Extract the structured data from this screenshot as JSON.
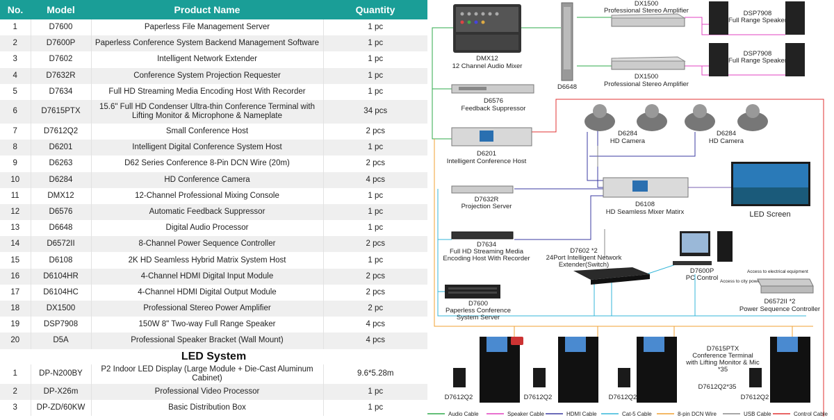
{
  "table": {
    "headers": [
      "No.",
      "Model",
      "Product Name",
      "Quantity"
    ],
    "rows": [
      {
        "no": "1",
        "model": "D7600",
        "name": "Paperless File Management Server",
        "qty": "1 pc"
      },
      {
        "no": "2",
        "model": "D7600P",
        "name": "Paperless Conference System Backend Management Software",
        "qty": "1 pc"
      },
      {
        "no": "3",
        "model": "D7602",
        "name": "Intelligent Network Extender",
        "qty": "1 pc"
      },
      {
        "no": "4",
        "model": "D7632R",
        "name": "Conference System Projection Requester",
        "qty": "1 pc"
      },
      {
        "no": "5",
        "model": "D7634",
        "name": "Full HD Streaming Media Encoding Host With Recorder",
        "qty": "1 pc"
      },
      {
        "no": "6",
        "model": "D7615PTX",
        "name": "15.6\" Full HD Condenser Ultra-thin Conference Terminal with Lifting Monitor & Microphone & Nameplate",
        "qty": "34 pcs"
      },
      {
        "no": "7",
        "model": "D7612Q2",
        "name": "Small Conference Host",
        "qty": "2 pcs"
      },
      {
        "no": "8",
        "model": "D6201",
        "name": "Intelligent Digital Conference System Host",
        "qty": "1 pc"
      },
      {
        "no": "9",
        "model": "D6263",
        "name": "D62 Series Conference 8-Pin DCN Wire (20m)",
        "qty": "2 pcs"
      },
      {
        "no": "10",
        "model": "D6284",
        "name": "HD Conference Camera",
        "qty": "4 pcs"
      },
      {
        "no": "11",
        "model": "DMX12",
        "name": "12-Channel Professional Mixing Console",
        "qty": "1 pc"
      },
      {
        "no": "12",
        "model": "D6576",
        "name": "Automatic Feedback Suppressor",
        "qty": "1 pc"
      },
      {
        "no": "13",
        "model": "D6648",
        "name": "Digital Audio Processor",
        "qty": "1 pc"
      },
      {
        "no": "14",
        "model": "D6572II",
        "name": "8-Channel Power Sequence Controller",
        "qty": "2 pcs"
      },
      {
        "no": "15",
        "model": "D6108",
        "name": "2K HD Seamless Hybrid Matrix System Host",
        "qty": "1 pc"
      },
      {
        "no": "16",
        "model": "D6104HR",
        "name": "4-Channel HDMI Digital Input Module",
        "qty": "2 pcs"
      },
      {
        "no": "17",
        "model": "D6104HC",
        "name": "4-Channel HDMI Digital Output Module",
        "qty": "2 pcs"
      },
      {
        "no": "18",
        "model": "DX1500",
        "name": "Professional Stereo Power Amplifier",
        "qty": "2 pc"
      },
      {
        "no": "19",
        "model": "DSP7908",
        "name": "150W 8\" Two-way Full Range Speaker",
        "qty": "4 pcs"
      },
      {
        "no": "20",
        "model": "D5A",
        "name": "Professional Speaker Bracket (Wall Mount)",
        "qty": "4 pcs"
      }
    ],
    "led_title": "LED System",
    "led_rows": [
      {
        "no": "1",
        "model": "DP-N200BY",
        "name": "P2 Indoor LED Display  (Large Module + Die-Cast Aluminum Cabinet)",
        "qty": "9.6*5.28m"
      },
      {
        "no": "2",
        "model": "DP-X26m",
        "name": "Professional Video Processor",
        "qty": "1 pc"
      },
      {
        "no": "3",
        "model": "DP-ZD/60KW",
        "name": "Basic Distribution Box",
        "qty": "1 pc"
      }
    ]
  },
  "diagram": {
    "dx1500_top": {
      "model": "DX1500",
      "name": "Professional Stereo Amplifier"
    },
    "dx1500_bottom": {
      "model": "DX1500",
      "name": "Professional Stereo Amplifier"
    },
    "dsp_top": {
      "model": "DSP7908",
      "name": "Full Range Speaker"
    },
    "dsp_bottom": {
      "model": "DSP7908",
      "name": "Full Range Speaker"
    },
    "dmx12": {
      "model": "DMX12",
      "name": "12 Channel Audio Mixer"
    },
    "d6648": "D6648",
    "d6576": {
      "model": "D6576",
      "name": "Feedback Suppressor"
    },
    "d6201": {
      "model": "D6201",
      "name": "Intelligent Conference Host"
    },
    "d6284_left": {
      "model": "D6284",
      "name": "HD Camera"
    },
    "d6284_right": {
      "model": "D6284",
      "name": "HD Camera"
    },
    "d7632r": {
      "model": "D7632R",
      "name": "Projection Server"
    },
    "d6108": {
      "model": "D6108",
      "name": "HD Seamless Mixer Matirx"
    },
    "led_screen": "LED Screen",
    "d7634": {
      "model": "D7634",
      "line1": "Full HD Streaming Media",
      "line2": "Encoding Host With Recorder"
    },
    "d7602": {
      "line1": "D7602 *2",
      "line2": "24Port Intelligent Network",
      "line3": "Extender(Switch)"
    },
    "d7600p": {
      "model": "D7600P",
      "name": "PC Control"
    },
    "d7600": {
      "model": "D7600",
      "line1": "Paperless Conference",
      "line2": "System Server"
    },
    "access_electrical": "Access to electrical equipment",
    "access_city": "Access to city power",
    "d6572": {
      "model": "D6572II *2",
      "name": "Power Sequence Controller"
    },
    "d7615": {
      "line1": "D7615PTX",
      "line2": "Conference Terminal",
      "line3": "with Lifting Monitor & Mic",
      "line4": "*35"
    },
    "d7612_mid": "D7612Q2*35",
    "d7612_labels": [
      "D7612Q2",
      "D7612Q2",
      "D7612Q2",
      "D7612Q2"
    ],
    "legend": [
      {
        "label": "Audio Cable",
        "color": "#2eaa4a"
      },
      {
        "label": "Speaker Cable",
        "color": "#e040c0"
      },
      {
        "label": "HDMI Cable",
        "color": "#3a3aa0"
      },
      {
        "label": "Cat-5 Cable",
        "color": "#33b5d8"
      },
      {
        "label": "8-pin DCN Wire",
        "color": "#f0a030"
      },
      {
        "label": "USB Cable",
        "color": "#888888"
      },
      {
        "label": "Control Cable",
        "color": "#e03030"
      }
    ]
  }
}
